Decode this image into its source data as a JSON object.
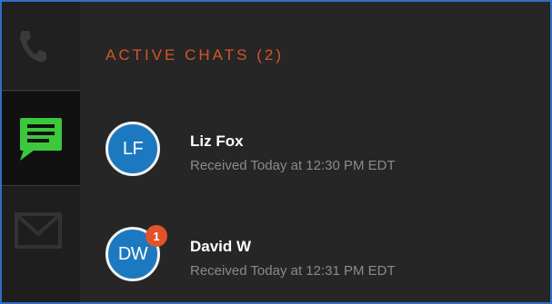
{
  "rail": {
    "items": [
      {
        "icon": "phone-icon",
        "active": false
      },
      {
        "icon": "chat-icon",
        "active": true,
        "color": "#3cc83c"
      },
      {
        "icon": "mail-icon",
        "active": false
      }
    ]
  },
  "section": {
    "title": "ACTIVE CHATS (2)",
    "title_color": "#d4552a"
  },
  "chats": [
    {
      "initials": "LF",
      "name": "Liz Fox",
      "received": "Received Today at 12:30 PM EDT",
      "badge": ""
    },
    {
      "initials": "DW",
      "name": "David W",
      "received": "Received Today at 12:31 PM EDT",
      "badge": "1"
    }
  ],
  "colors": {
    "avatar_bg": "#1c79c0",
    "badge_bg": "#e0532b",
    "frame_border": "#2f6fc4"
  }
}
